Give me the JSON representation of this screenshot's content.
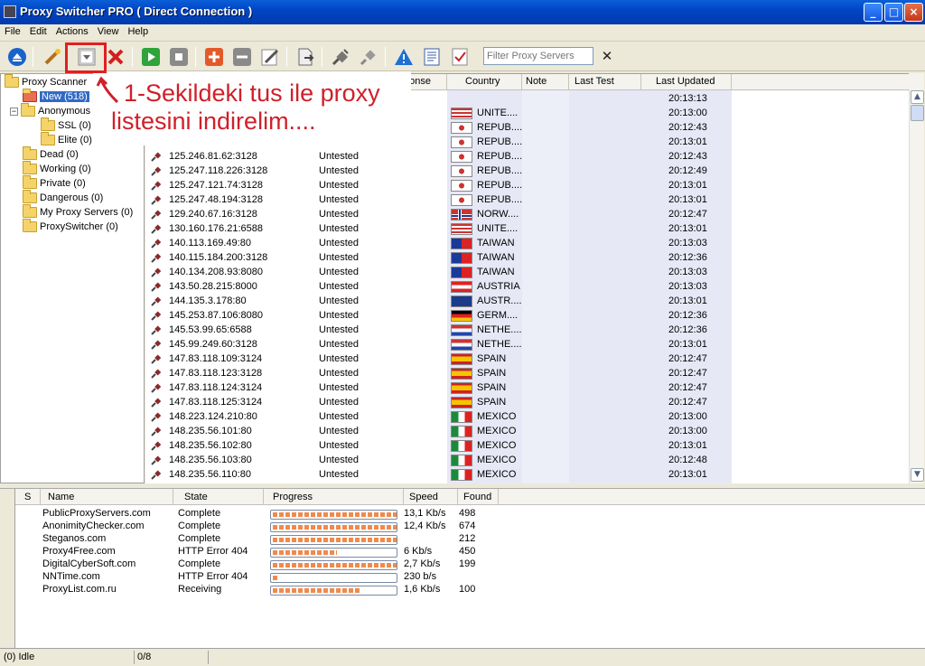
{
  "window": {
    "title": "Proxy Switcher PRO ( Direct Connection )"
  },
  "menu": [
    "File",
    "Edit",
    "Actions",
    "View",
    "Help"
  ],
  "toolbar": {
    "filter_placeholder": "Filter Proxy Servers"
  },
  "tree": {
    "root": "Proxy Scanner",
    "new": "New (518)",
    "anonymous": "Anonymous (0)",
    "ssl": "SSL (0)",
    "elite": "Elite (0)",
    "dead": "Dead (0)",
    "working": "Working (0)",
    "private": "Private (0)",
    "dangerous": "Dangerous (0)",
    "my_proxy": "My Proxy Servers (0)",
    "proxyswitcher": "ProxySwitcher (0)"
  },
  "grid": {
    "headers": {
      "response": "ponse",
      "country": "Country",
      "note": "Note",
      "last_test": "Last Test",
      "last_updated": "Last Updated"
    },
    "top_rows": [
      {
        "country": "",
        "updated": "20:13:13"
      },
      {
        "country": "UNITE....",
        "updated": "20:13:00"
      },
      {
        "country": "REPUB....",
        "updated": "20:12:43"
      },
      {
        "country": "REPUB....",
        "updated": "20:13:01"
      }
    ],
    "rows": [
      {
        "ip": "125.246.81.62:3128",
        "status": "Untested",
        "country": "REPUB....",
        "updated": "20:12:43"
      },
      {
        "ip": "125.247.118.226:3128",
        "status": "Untested",
        "country": "REPUB....",
        "updated": "20:12:49"
      },
      {
        "ip": "125.247.121.74:3128",
        "status": "Untested",
        "country": "REPUB....",
        "updated": "20:13:01"
      },
      {
        "ip": "125.247.48.194:3128",
        "status": "Untested",
        "country": "REPUB....",
        "updated": "20:13:01"
      },
      {
        "ip": "129.240.67.16:3128",
        "status": "Untested",
        "country": "NORW....",
        "updated": "20:12:47"
      },
      {
        "ip": "130.160.176.21:6588",
        "status": "Untested",
        "country": "UNITE....",
        "updated": "20:13:01"
      },
      {
        "ip": "140.113.169.49:80",
        "status": "Untested",
        "country": "TAIWAN",
        "updated": "20:13:03"
      },
      {
        "ip": "140.115.184.200:3128",
        "status": "Untested",
        "country": "TAIWAN",
        "updated": "20:12:36"
      },
      {
        "ip": "140.134.208.93:8080",
        "status": "Untested",
        "country": "TAIWAN",
        "updated": "20:13:03"
      },
      {
        "ip": "143.50.28.215:8000",
        "status": "Untested",
        "country": "AUSTRIA",
        "updated": "20:13:03"
      },
      {
        "ip": "144.135.3.178:80",
        "status": "Untested",
        "country": "AUSTR....",
        "updated": "20:13:01"
      },
      {
        "ip": "145.253.87.106:8080",
        "status": "Untested",
        "country": "GERM....",
        "updated": "20:12:36"
      },
      {
        "ip": "145.53.99.65:6588",
        "status": "Untested",
        "country": "NETHE....",
        "updated": "20:12:36"
      },
      {
        "ip": "145.99.249.60:3128",
        "status": "Untested",
        "country": "NETHE....",
        "updated": "20:13:01"
      },
      {
        "ip": "147.83.118.109:3124",
        "status": "Untested",
        "country": "SPAIN",
        "updated": "20:12:47"
      },
      {
        "ip": "147.83.118.123:3128",
        "status": "Untested",
        "country": "SPAIN",
        "updated": "20:12:47"
      },
      {
        "ip": "147.83.118.124:3124",
        "status": "Untested",
        "country": "SPAIN",
        "updated": "20:12:47"
      },
      {
        "ip": "147.83.118.125:3124",
        "status": "Untested",
        "country": "SPAIN",
        "updated": "20:12:47"
      },
      {
        "ip": "148.223.124.210:80",
        "status": "Untested",
        "country": "MEXICO",
        "updated": "20:13:00"
      },
      {
        "ip": "148.235.56.101:80",
        "status": "Untested",
        "country": "MEXICO",
        "updated": "20:13:00"
      },
      {
        "ip": "148.235.56.102:80",
        "status": "Untested",
        "country": "MEXICO",
        "updated": "20:13:01"
      },
      {
        "ip": "148.235.56.103:80",
        "status": "Untested",
        "country": "MEXICO",
        "updated": "20:12:48"
      },
      {
        "ip": "148.235.56.110:80",
        "status": "Untested",
        "country": "MEXICO",
        "updated": "20:13:01"
      }
    ]
  },
  "callout": {
    "line1": "1-Sekildeki tus ile proxy",
    "line2": "listesini indirelim....",
    "color": "#d0202a"
  },
  "scanner": {
    "headers": {
      "s": "S",
      "name": "Name",
      "state": "State",
      "progress": "Progress",
      "speed": "Speed",
      "found": "Found"
    },
    "rows": [
      {
        "name": "PublicProxyServers.com",
        "state": "Complete",
        "progress": 1.0,
        "speed": "13,1 Kb/s",
        "found": "498"
      },
      {
        "name": "AnonimityChecker.com",
        "state": "Complete",
        "progress": 1.0,
        "speed": "12,4 Kb/s",
        "found": "674"
      },
      {
        "name": "Steganos.com",
        "state": "Complete",
        "progress": 1.0,
        "speed": "",
        "found": "212"
      },
      {
        "name": "Proxy4Free.com",
        "state": "HTTP Error 404",
        "progress": 0.52,
        "speed": "6 Kb/s",
        "found": "450"
      },
      {
        "name": "DigitalCyberSoft.com",
        "state": "Complete",
        "progress": 1.0,
        "speed": "2,7 Kb/s",
        "found": "199"
      },
      {
        "name": "NNTime.com",
        "state": "HTTP Error 404",
        "progress": 0.05,
        "speed": "230 b/s",
        "found": ""
      },
      {
        "name": "ProxyList.com.ru",
        "state": "Receiving",
        "progress": 0.7,
        "speed": "1,6 Kb/s",
        "found": "100"
      }
    ]
  },
  "status": {
    "left": "(0) Idle",
    "count": "0/8"
  }
}
